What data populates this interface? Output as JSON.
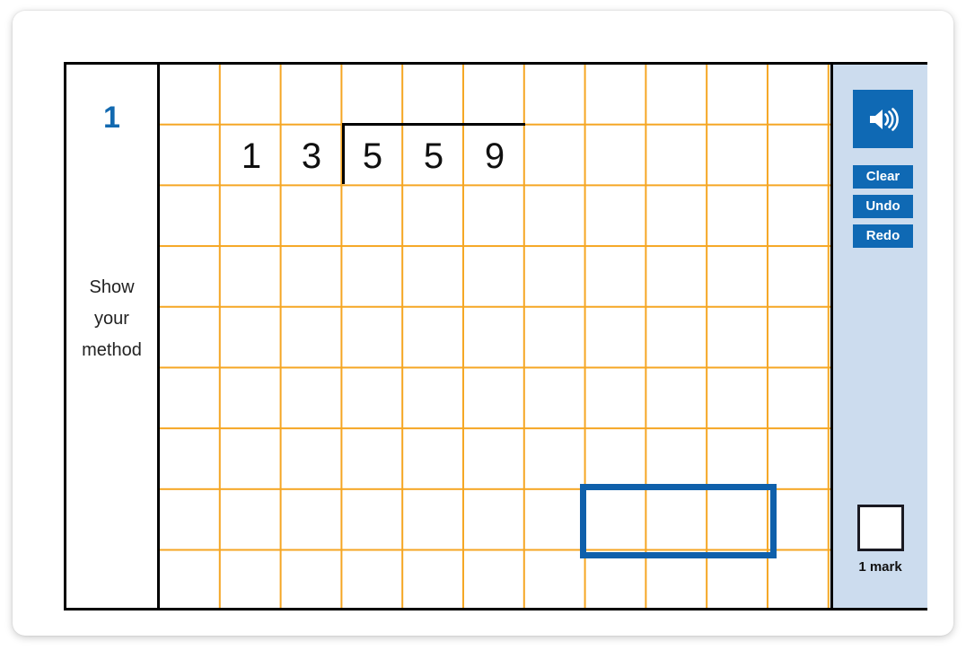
{
  "question": {
    "number": "1",
    "show_method_lines": [
      "Show",
      "your",
      "method"
    ],
    "type": "short-division-bus-stop"
  },
  "grid": {
    "columns": 11,
    "rows": 9,
    "line_color": "#f5a623",
    "cell_size_px": 68,
    "digits": [
      {
        "text": "1",
        "col": 1,
        "row": 1,
        "inside_bracket": false
      },
      {
        "text": "3",
        "col": 2,
        "row": 1,
        "inside_bracket": false
      },
      {
        "text": "5",
        "col": 3,
        "row": 1,
        "inside_bracket": true
      },
      {
        "text": "5",
        "col": 4,
        "row": 1,
        "inside_bracket": true
      },
      {
        "text": "9",
        "col": 5,
        "row": 1,
        "inside_bracket": true
      }
    ],
    "divisor_text": "13",
    "dividend_text": "559",
    "bracket": {
      "col_start": 3,
      "row": 1,
      "span_cols": 3
    }
  },
  "answer_box": {
    "value": "",
    "placeholder": "",
    "border_color": "#0f60ab"
  },
  "sidebar": {
    "audio_icon": "speaker-icon",
    "buttons": [
      {
        "label": "Clear",
        "name": "clear-button"
      },
      {
        "label": "Undo",
        "name": "undo-button"
      },
      {
        "label": "Redo",
        "name": "redo-button"
      }
    ],
    "mark": {
      "box_value": "",
      "label": "1 mark"
    }
  },
  "colors": {
    "accent_blue": "#0f69b4",
    "question_number_blue": "#1269b0",
    "sidebar_bg": "#ccdcee",
    "grid_orange": "#f5a623",
    "answer_border": "#0f60ab"
  }
}
